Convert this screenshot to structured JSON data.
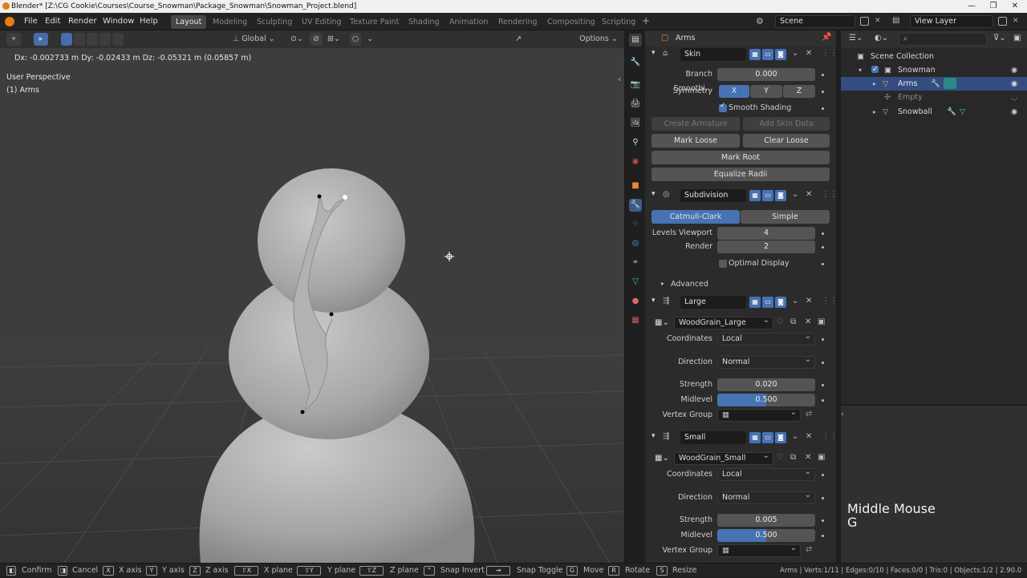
{
  "window": {
    "title": "Blender* [Z:\\CG Cookie\\Courses\\Course_Snowman\\Package_Snowman\\Snowman_Project.blend]",
    "controls": [
      "—",
      "❐",
      "✕"
    ]
  },
  "menu": [
    "File",
    "Edit",
    "Render",
    "Window",
    "Help"
  ],
  "workspaces": [
    "Layout",
    "Modeling",
    "Sculpting",
    "UV Editing",
    "Texture Paint",
    "Shading",
    "Animation",
    "Rendering",
    "Compositing",
    "Scripting"
  ],
  "active_workspace": "Layout",
  "scene": {
    "label": "Scene",
    "view_layer": "View Layer"
  },
  "viewport": {
    "transform_orientation": "Global",
    "options_label": "Options",
    "delta_text": "Dx: -0.002733 m   Dy: -0.02433 m   Dz: -0.05321 m (0.05857 m)",
    "perspective_label": "User Perspective",
    "object_label": "(1) Arms"
  },
  "properties": {
    "object_name": "Arms",
    "skin": {
      "name": "Skin",
      "branch_label": "Branch Smoothi...",
      "branch_value": "0.000",
      "symmetry_label": "Symmetry",
      "symmetry_axes": [
        "X",
        "Y",
        "Z"
      ],
      "smooth_shading_label": "Smooth Shading",
      "create_armature": "Create Armature",
      "add_skin_data": "Add Skin Data",
      "mark_loose": "Mark Loose",
      "clear_loose": "Clear Loose",
      "mark_root": "Mark Root",
      "equalize_radii": "Equalize Radii"
    },
    "subdivision": {
      "name": "Subdivision",
      "catmull": "Catmull-Clark",
      "simple": "Simple",
      "levels_label": "Levels Viewport",
      "levels_value": "4",
      "render_label": "Render",
      "render_value": "2",
      "optimal_label": "Optimal Display",
      "advanced_label": "Advanced"
    },
    "large": {
      "name": "Large",
      "texture": "WoodGrain_Large",
      "coordinates_label": "Coordinates",
      "coordinates_value": "Local",
      "direction_label": "Direction",
      "direction_value": "Normal",
      "strength_label": "Strength",
      "strength_value": "0.020",
      "midlevel_label": "Midlevel",
      "midlevel_value": "0.500",
      "vertex_group_label": "Vertex Group"
    },
    "small": {
      "name": "Small",
      "texture": "WoodGrain_Small",
      "coordinates_label": "Coordinates",
      "coordinates_value": "Local",
      "direction_label": "Direction",
      "direction_value": "Normal",
      "strength_label": "Strength",
      "strength_value": "0.005",
      "midlevel_label": "Midlevel",
      "midlevel_value": "0.500",
      "vertex_group_label": "Vertex Group"
    }
  },
  "outliner": {
    "root": "Scene Collection",
    "items": [
      {
        "label": "Snowman",
        "type": "collection"
      },
      {
        "label": "Arms",
        "type": "mesh"
      },
      {
        "label": "Empty",
        "type": "empty"
      },
      {
        "label": "Snowball",
        "type": "mesh"
      }
    ]
  },
  "key_overlay": {
    "line1": "Middle Mouse",
    "line2": "G"
  },
  "statusbar": {
    "items": [
      {
        "key": "",
        "label": "Confirm"
      },
      {
        "key": "",
        "label": "Cancel"
      },
      {
        "key": "X",
        "label": "X axis"
      },
      {
        "key": "Y",
        "label": "Y axis"
      },
      {
        "key": "Z",
        "label": "Z axis"
      },
      {
        "key": "⇧X",
        "label": "X plane"
      },
      {
        "key": "⇧Y",
        "label": "Y plane"
      },
      {
        "key": "⇧Z",
        "label": "Z plane"
      },
      {
        "key": "",
        "label": "Snap Invert"
      },
      {
        "key": "",
        "label": "Snap Toggle"
      },
      {
        "key": "G",
        "label": "Move"
      },
      {
        "key": "R",
        "label": "Rotate"
      },
      {
        "key": "S",
        "label": "Resize"
      }
    ],
    "stats": "Arms | Verts:1/11 | Edges:0/10 | Faces:0/0 | Tris:0 | Objects:1/2 | 2.90.0"
  },
  "colors": {
    "accent": "#4772b3",
    "viewport_bg": "#3c3c3c",
    "panel_bg": "#2b2b2b"
  }
}
